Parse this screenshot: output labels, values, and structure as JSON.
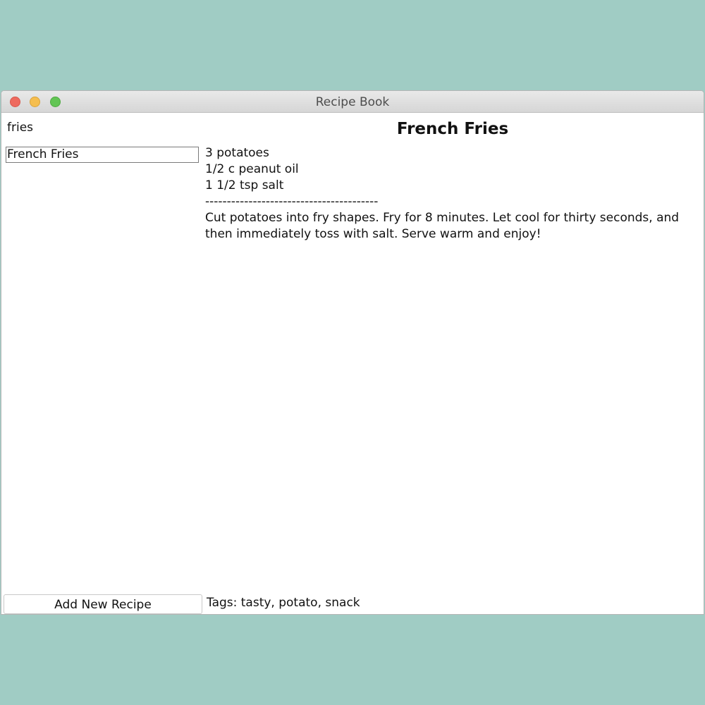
{
  "window": {
    "title": "Recipe Book"
  },
  "search": {
    "value": "fries"
  },
  "recipe_list": {
    "items": [
      {
        "label": "French Fries"
      }
    ]
  },
  "recipe": {
    "title": "French Fries",
    "ingredients": [
      "3 potatoes",
      "1/2 c peanut oil",
      "1 1/2 tsp salt"
    ],
    "separator": "----------------------------------------",
    "instructions": "Cut potatoes into fry shapes. Fry for 8 minutes. Let cool for thirty seconds, and then immediately toss with salt. Serve warm and enjoy!",
    "tags": "Tags: tasty, potato, snack"
  },
  "actions": {
    "add_label": "Add New Recipe"
  },
  "colors": {
    "background": "#a0ccc4",
    "close": "#ee6a5f",
    "minimize": "#f5be4f",
    "maximize": "#62c554"
  }
}
